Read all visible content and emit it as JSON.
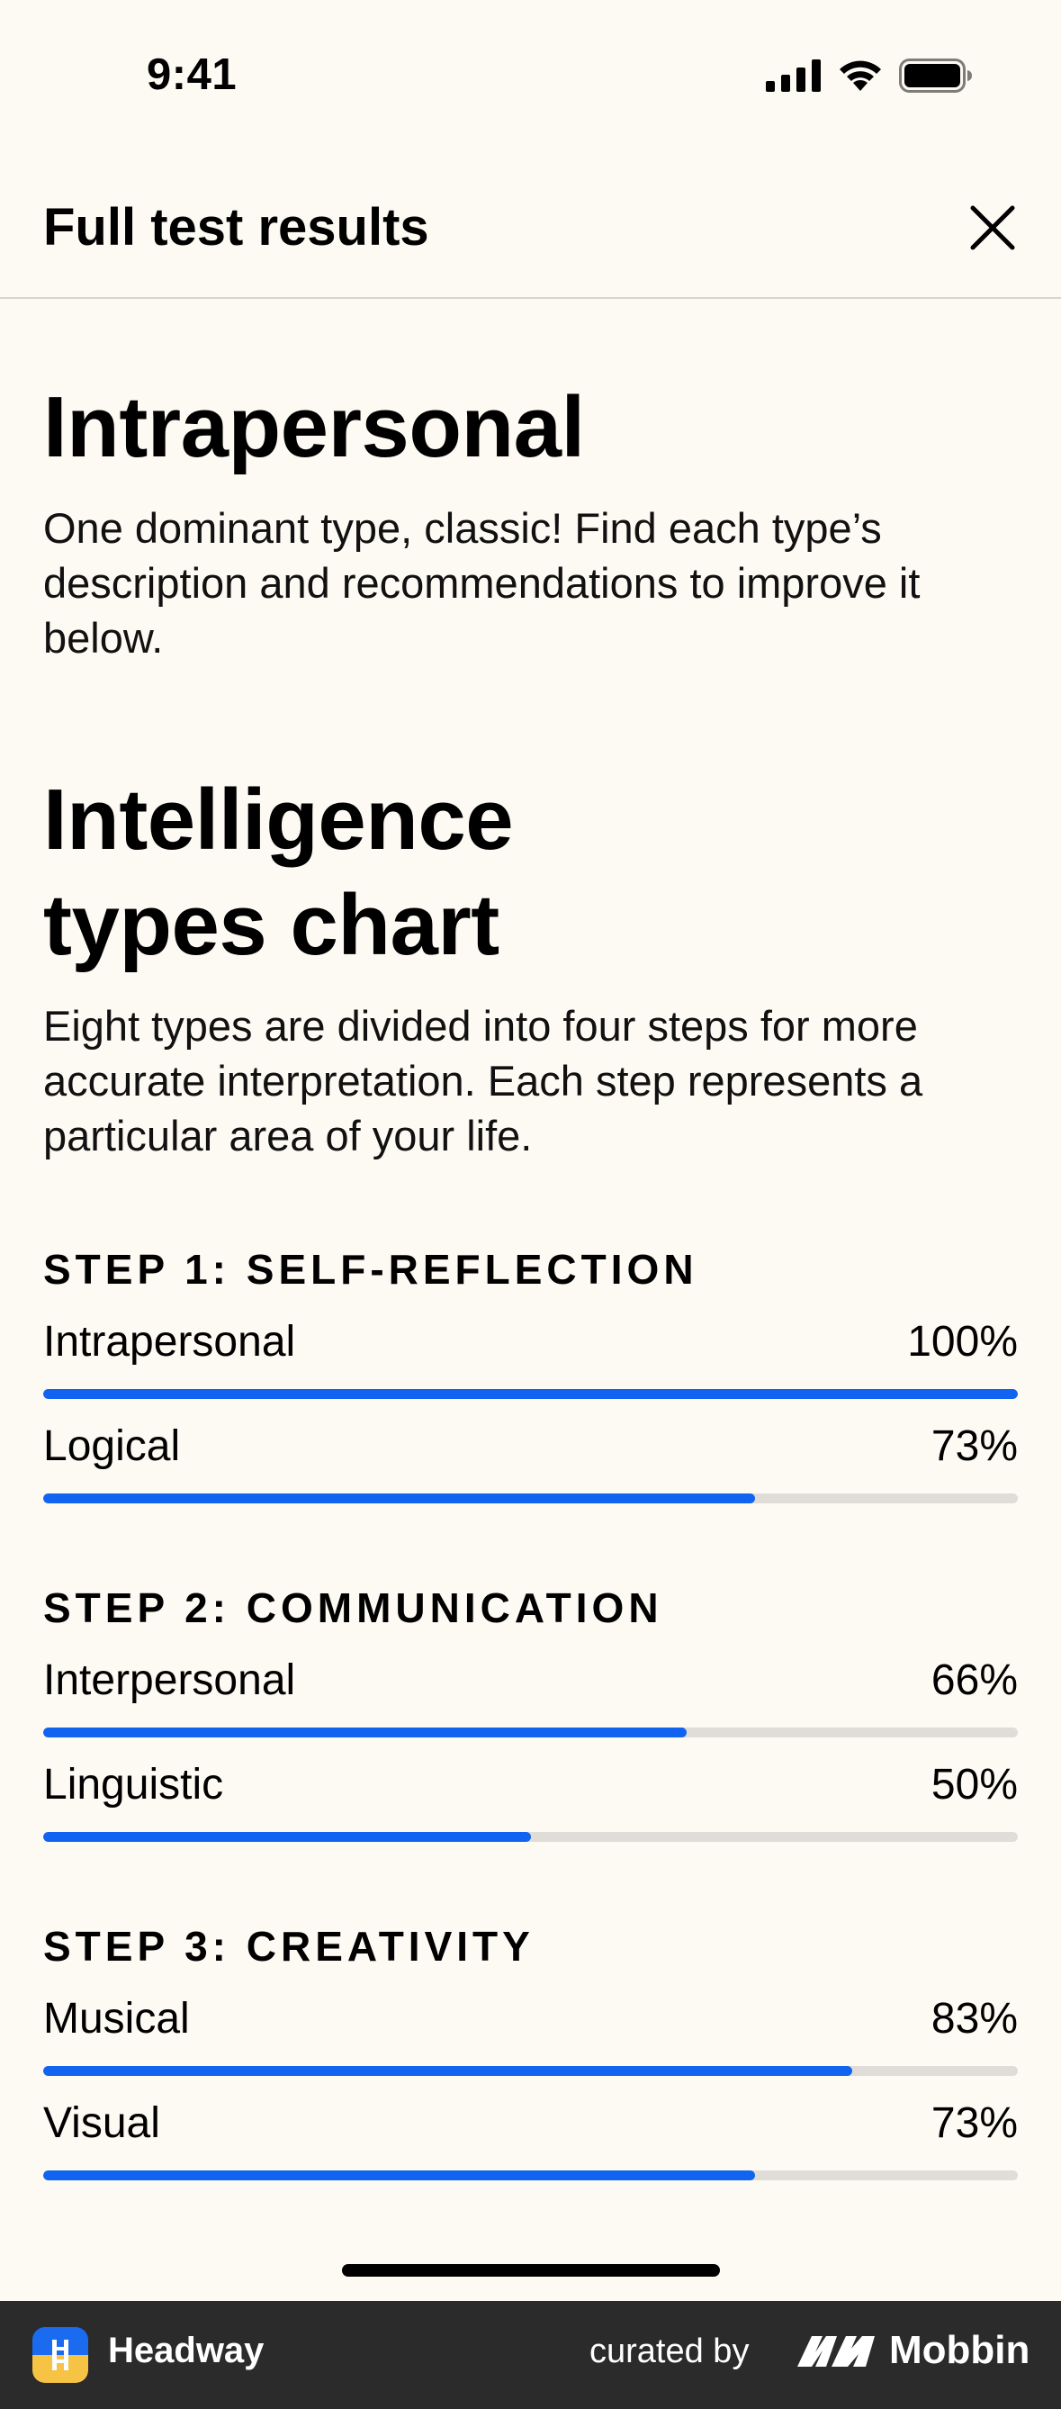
{
  "status_bar": {
    "time": "9:41"
  },
  "header": {
    "title": "Full test results"
  },
  "main": {
    "result_title": "Intrapersonal",
    "result_description": "One dominant type, classic! Find each type’s description and recommendations to improve it below.",
    "chart_title_line1": "Intelligence",
    "chart_title_line2": "types chart",
    "chart_description": "Eight types are divided into four steps for more accurate interpretation. Each step represents a particular area of your life."
  },
  "steps": [
    {
      "title": "STEP 1: SELF-REFLECTION",
      "items": [
        {
          "label": "Intrapersonal",
          "value_text": "100%",
          "value": 100
        },
        {
          "label": "Logical",
          "value_text": "73%",
          "value": 73
        }
      ]
    },
    {
      "title": "STEP 2: COMMUNICATION",
      "items": [
        {
          "label": "Interpersonal",
          "value_text": "66%",
          "value": 66
        },
        {
          "label": "Linguistic",
          "value_text": "50%",
          "value": 50
        }
      ]
    },
    {
      "title": "STEP 3: CREATIVITY",
      "items": [
        {
          "label": "Musical",
          "value_text": "83%",
          "value": 83
        },
        {
          "label": "Visual",
          "value_text": "73%",
          "value": 73
        }
      ]
    }
  ],
  "colors": {
    "background": "#FDF9F3",
    "accent": "#1064F0",
    "track": "#E0DDD8",
    "footer": "#2B2B2B"
  },
  "footer": {
    "app_name": "Headway",
    "curated_by": "curated by",
    "brand": "Mobbin",
    "app_icon": "headway-app-icon",
    "brand_icon": "mobbin-logo-icon"
  }
}
